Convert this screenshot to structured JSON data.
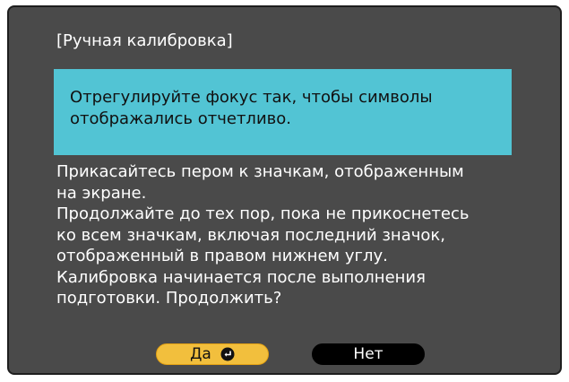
{
  "dialog": {
    "title": "[Ручная калибровка]",
    "highlight_lines": [
      "Отрегулируйте фокус так, чтобы символы",
      "отображались отчетливо."
    ],
    "message_lines": [
      "Прикасайтесь пером к значкам, отображенным",
      "на экране.",
      "Продолжайте до тех пор, пока не прикоснетесь",
      "ко всем значкам, включая последний значок,",
      "отображенный в правом нижнем углу.",
      "Калибровка начинается после выполнения",
      "подготовки. Продолжить?"
    ],
    "buttons": {
      "yes_label": "Да",
      "no_label": "Нет"
    }
  },
  "icons": {
    "enter": "enter-icon"
  },
  "colors": {
    "dialog_background": "#4a4a4a",
    "highlight_background": "#52c4d4",
    "yes_button": "#f2bf3d",
    "no_button": "#000000"
  }
}
